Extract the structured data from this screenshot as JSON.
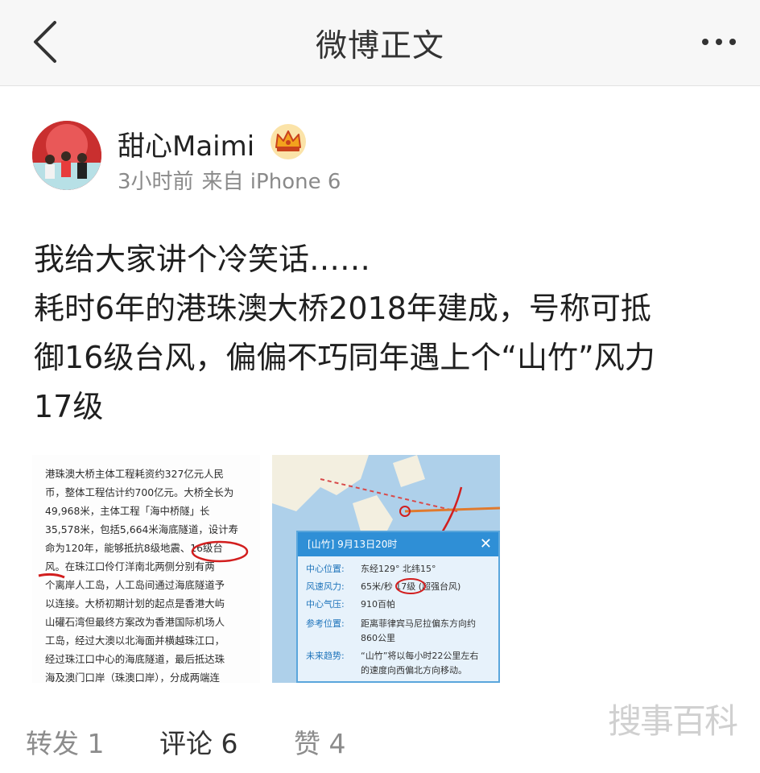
{
  "header": {
    "title": "微博正文"
  },
  "author": {
    "name": "甜心Maimi",
    "time": "3小时前",
    "source": "来自 iPhone 6"
  },
  "post": {
    "lines": [
      "我给大家讲个冷笑话……",
      "耗时6年的港珠澳大桥2018年建成，号称可抵",
      "御16级台风，偏偏不巧同年遇上个“山竹”风力",
      "17级"
    ]
  },
  "image1": {
    "lines": [
      "港珠澳大桥主体工程耗资约327亿元人民",
      "币，整体工程估计约700亿元。大桥全长为",
      "49,968米，主体工程「海中桥隧」长",
      "35,578米，包括5,664米海底隧道，设计寿",
      "命为120年，能够抵抗8级地震、16级台",
      "风。在珠江口伶仃洋南北两侧分别有两",
      "个离岸人工岛，人工岛间通过海底隧道予",
      "以连接。大桥初期计划的起点是香港大屿",
      "山礶石湾但最终方案改为香港国际机场人",
      "工岛，经过大澳以北海面并横越珠江口，",
      "经过珠江口中心的海底隧道，最后抵达珠",
      "海及澳门口岸（珠澳口岸），分成两端连"
    ]
  },
  "image2": {
    "popup_title": "[山竹] 9月13日20时",
    "rows": [
      {
        "k": "中心位置:",
        "v": "东经129°  北纬15°"
      },
      {
        "k": "风速风力:",
        "v": "65米/秒 17级 (超强台风)"
      },
      {
        "k": "中心气压:",
        "v": "910百帕"
      },
      {
        "k": "参考位置:",
        "v": "距离菲律宾马尼拉偏东方向约"
      },
      {
        "k": "",
        "v": "860公里"
      },
      {
        "k": "未来趋势:",
        "v": "“山竹”将以每小时22公里左右"
      },
      {
        "k": "",
        "v": "的速度向西偏北方向移动。"
      }
    ]
  },
  "actions": {
    "repost": "转发 1",
    "comment": "评论 6",
    "like": "赞 4"
  },
  "watermark": "搜事百科",
  "colors": {
    "header_bg": "#f7f7f7",
    "meta_gray": "#8a8a8a",
    "link_blue": "#2a77c9",
    "crown_orange": "#f3a21d"
  },
  "icons": [
    "back-arrow-icon",
    "more-dots-icon",
    "crown-icon"
  ]
}
